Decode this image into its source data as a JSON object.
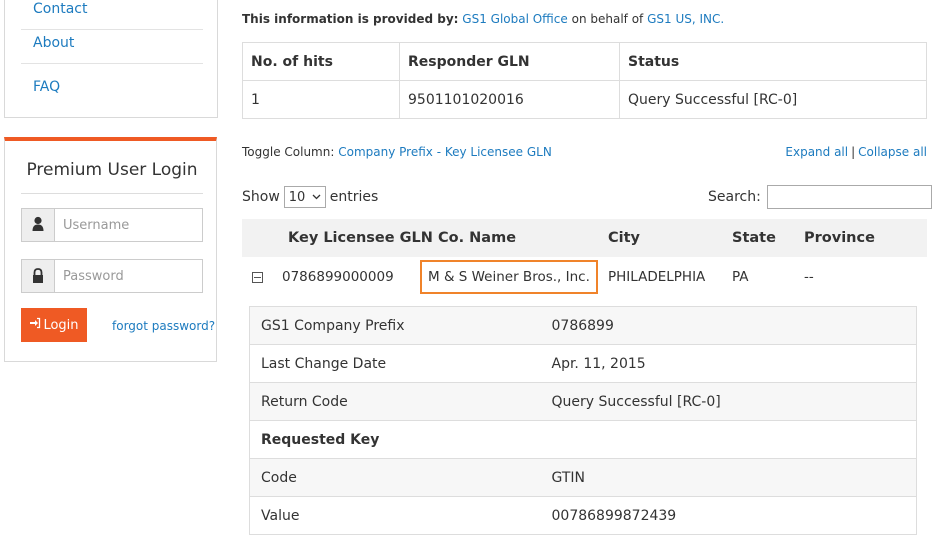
{
  "sidebar": {
    "nav": [
      {
        "label": "Contact"
      },
      {
        "label": "About"
      },
      {
        "label": "FAQ"
      }
    ],
    "login": {
      "title": "Premium User Login",
      "username_placeholder": "Username",
      "password_placeholder": "Password",
      "login_label": "Login",
      "forgot_label": "forgot password?"
    }
  },
  "info": {
    "prefix": "This information is provided by:",
    "provider": "GS1 Global Office",
    "middle": "on behalf of",
    "member": "GS1 US, INC."
  },
  "hits_table": {
    "headers": [
      "No. of hits",
      "Responder GLN",
      "Status"
    ],
    "row": [
      "1",
      "9501101020016",
      "Query Successful [RC-0]"
    ]
  },
  "controls": {
    "toggle_prefix": "Toggle Column:",
    "toggle_link": "Company Prefix - Key Licensee GLN",
    "expand_all": "Expand all",
    "separator": "|",
    "collapse_all": "Collapse all",
    "show_label": "Show",
    "entries_value": "10",
    "entries_label": "entries",
    "search_label": "Search:"
  },
  "main_table": {
    "headers": [
      "Key Licensee GLN",
      "Co. Name",
      "City",
      "State",
      "Province"
    ],
    "row": {
      "gln": "0786899000009",
      "name": "M & S Weiner Bros., Inc.",
      "city": "PHILADELPHIA",
      "state": "PA",
      "province": "--"
    }
  },
  "details": [
    {
      "key": "GS1 Company Prefix",
      "value": "0786899"
    },
    {
      "key": "Last Change Date",
      "value": "Apr. 11, 2015"
    },
    {
      "key": "Return Code",
      "value": "Query Successful  [RC-0]"
    },
    {
      "key": "Requested Key",
      "value": ""
    },
    {
      "key": "Code",
      "value": "GTIN"
    },
    {
      "key": "Value",
      "value": "00786899872439"
    }
  ],
  "colors": {
    "accent": "#ef5a24",
    "link": "#1d7bbf",
    "highlight": "#f0832a"
  }
}
